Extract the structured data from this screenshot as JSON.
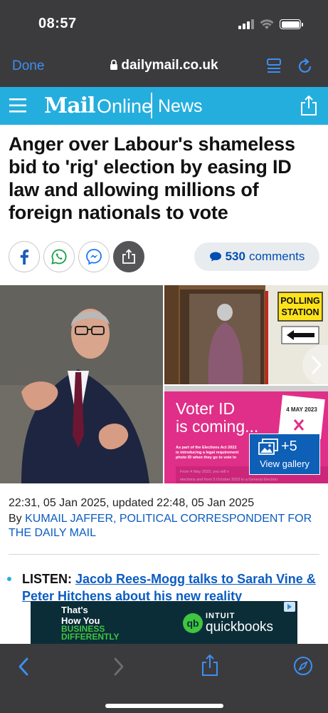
{
  "status_bar": {
    "time": "08:57"
  },
  "browser": {
    "done_label": "Done",
    "url": "dailymail.co.uk"
  },
  "header": {
    "logo_mail": "Mail",
    "logo_online": "Online",
    "section": "News"
  },
  "article": {
    "headline": "Anger over Labour's shameless bid to 'rig' election by easing ID law and allowing millions of foreign nationals to vote",
    "comments_count": "530",
    "comments_label": "comments",
    "dateline": "22:31, 05 Jan 2025, updated 22:48, 05 Jan 2025",
    "byline_prefix": "By",
    "byline_author": "Kumail Jaffer, Political Correspondent for The Daily Mail",
    "bullet_label": "LISTEN:",
    "bullet_link": "Jacob Rees-Mogg talks to Sarah Vine & Peter Hitchens about his new reality"
  },
  "gallery": {
    "polling_sign_line1": "POLLING",
    "polling_sign_line2": "STATION",
    "voter_id_line1": "Voter ID",
    "voter_id_line2": "is coming...",
    "voter_id_date": "4 MAY 2023",
    "voter_id_body1": "As part of the Elections Act 2022",
    "voter_id_body2": "is introducing a legal requirement",
    "voter_id_body3": "photo ID when they go to vote in",
    "voter_id_body4": "From 4 May 2023, you will n",
    "voter_id_body5": "elections and from 5 October 2023 in a General Election.",
    "more_count": "+5",
    "view_label": "View gallery"
  },
  "ad": {
    "line1": "That's",
    "line2": "How You",
    "line3": "BUSINESS",
    "line4": "DIFFERENTLY",
    "brand_top": "INTUIT",
    "brand": "quickbooks",
    "logo_mark": "qb"
  },
  "colors": {
    "chrome": "#3b3b3d",
    "ios_blue": "#3d8ff4",
    "mail_blue": "#24aede",
    "link_blue": "#0b5cc2"
  }
}
